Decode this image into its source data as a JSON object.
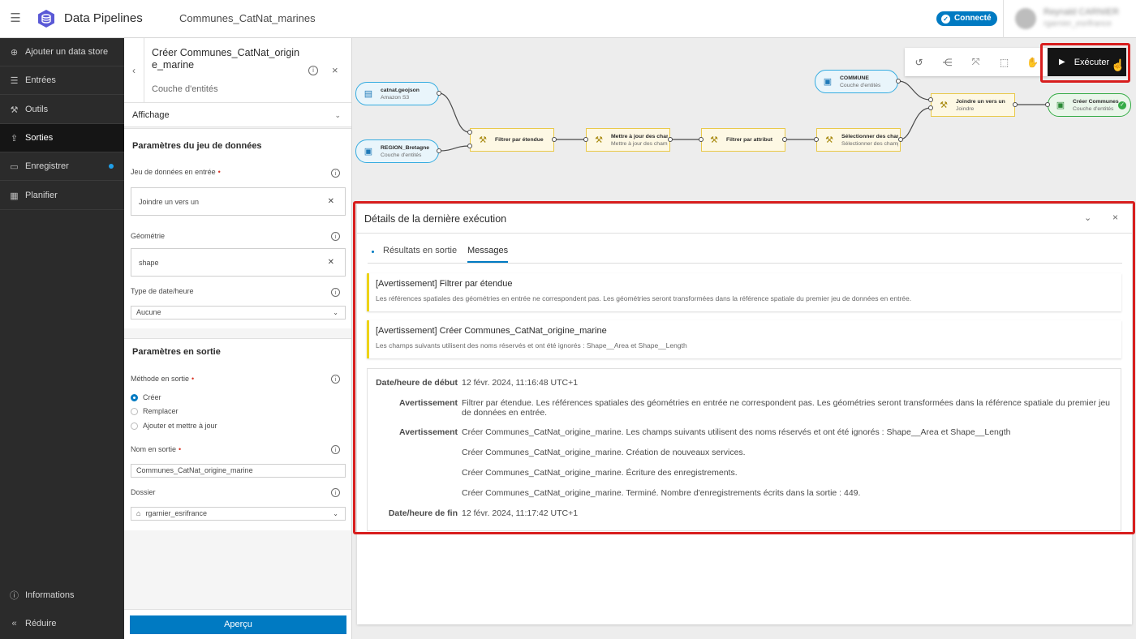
{
  "topbar": {
    "app_name": "Data Pipelines",
    "doc_name": "Communes_CatNat_marines",
    "status": "Connecté",
    "user_name": "Reynald CARNIER",
    "user_org": "rgarnier_esrifrance"
  },
  "nav": {
    "items": [
      {
        "label": "Ajouter un data store",
        "icon": "plus-circle-icon"
      },
      {
        "label": "Entrées",
        "icon": "database-icon"
      },
      {
        "label": "Outils",
        "icon": "hammer-icon"
      },
      {
        "label": "Sorties",
        "icon": "export-icon"
      },
      {
        "label": "Enregistrer",
        "icon": "save-icon"
      },
      {
        "label": "Planifier",
        "icon": "calendar-icon"
      }
    ],
    "bottom": [
      {
        "label": "Informations",
        "icon": "info-icon"
      },
      {
        "label": "Réduire",
        "icon": "collapse-icon"
      }
    ]
  },
  "panel": {
    "title": "Créer Communes_CatNat_origine_marine",
    "subtitle": "Couche d'entités",
    "display_section": "Affichage",
    "dataset_section": "Paramètres du jeu de données",
    "input_label": "Jeu de données en entrée",
    "input_value": "Joindre un vers un",
    "geometry_label": "Géométrie",
    "geometry_value": "shape",
    "datetime_label": "Type de date/heure",
    "datetime_value": "Aucune",
    "output_section": "Paramètres en sortie",
    "method_label": "Méthode en sortie",
    "methods": [
      "Créer",
      "Remplacer",
      "Ajouter et mettre à jour"
    ],
    "method_selected": "Créer",
    "name_label": "Nom en sortie",
    "name_value": "Communes_CatNat_origine_marine",
    "folder_label": "Dossier",
    "folder_value": "rgarnier_esrifrance",
    "preview_button": "Aperçu"
  },
  "canvas": {
    "nodes": {
      "catnat": {
        "title": "catnat.geojson",
        "sub": "Amazon S3"
      },
      "region": {
        "title": "REGION_Bretagne",
        "sub": "Couche d'entités"
      },
      "filtre_etendue": {
        "title": "Filtrer par étendue",
        "sub": ""
      },
      "mettre_a_jour": {
        "title": "Mettre à jour des champs",
        "sub": "Mettre à jour des champs"
      },
      "filtre_attribut": {
        "title": "Filtrer par attribut",
        "sub": ""
      },
      "selectionner": {
        "title": "Sélectionner des champs",
        "sub": "Sélectionner des champs"
      },
      "commune": {
        "title": "COMMUNE",
        "sub": "Couche d'entités"
      },
      "joindre": {
        "title": "Joindre un vers un",
        "sub": "Joindre"
      },
      "creer": {
        "title": "Créer Communes_CatNat_origine_marine",
        "sub": "Couche d'entités"
      }
    },
    "execute_button": "Exécuter"
  },
  "details": {
    "title": "Détails de la dernière exécution",
    "tabs": [
      "Résultats en sortie",
      "Messages"
    ],
    "active_tab": "Messages",
    "notices": [
      {
        "title": "[Avertissement] Filtrer par étendue",
        "text": "Les références spatiales des géométries en entrée ne correspondent pas. Les géométries seront transformées dans la référence spatiale du premier jeu de données en entrée."
      },
      {
        "title": "[Avertissement] Créer Communes_CatNat_origine_marine",
        "text": "Les champs suivants utilisent des noms réservés et ont été ignorés : Shape__Area et Shape__Length"
      }
    ],
    "log": [
      {
        "key": "Date/heure de début",
        "value": "12 févr. 2024, 11:16:48 UTC+1"
      },
      {
        "key": "Avertissement",
        "value": "Filtrer par étendue. Les références spatiales des géométries en entrée ne correspondent pas. Les géométries seront transformées dans la référence spatiale du premier jeu de données en entrée."
      },
      {
        "key": "Avertissement",
        "value": "Créer Communes_CatNat_origine_marine. Les champs suivants utilisent des noms réservés et ont été ignorés : Shape__Area et Shape__Length"
      },
      {
        "key": "",
        "value": "Créer Communes_CatNat_origine_marine. Création de nouveaux services."
      },
      {
        "key": "",
        "value": "Créer Communes_CatNat_origine_marine. Écriture des enregistrements."
      },
      {
        "key": "",
        "value": "Créer Communes_CatNat_origine_marine. Terminé. Nombre d'enregistrements écrits dans la sortie : 449."
      },
      {
        "key": "Date/heure de fin",
        "value": "12 févr. 2024, 11:17:42 UTC+1"
      }
    ]
  },
  "colors": {
    "accent": "#007ac2",
    "nav_bg": "#2b2b2b",
    "highlight": "#d81e1e",
    "warning": "#edd317",
    "input_node": "#35ace0",
    "tool_node": "#e9c94a",
    "output_node": "#35ac46"
  }
}
